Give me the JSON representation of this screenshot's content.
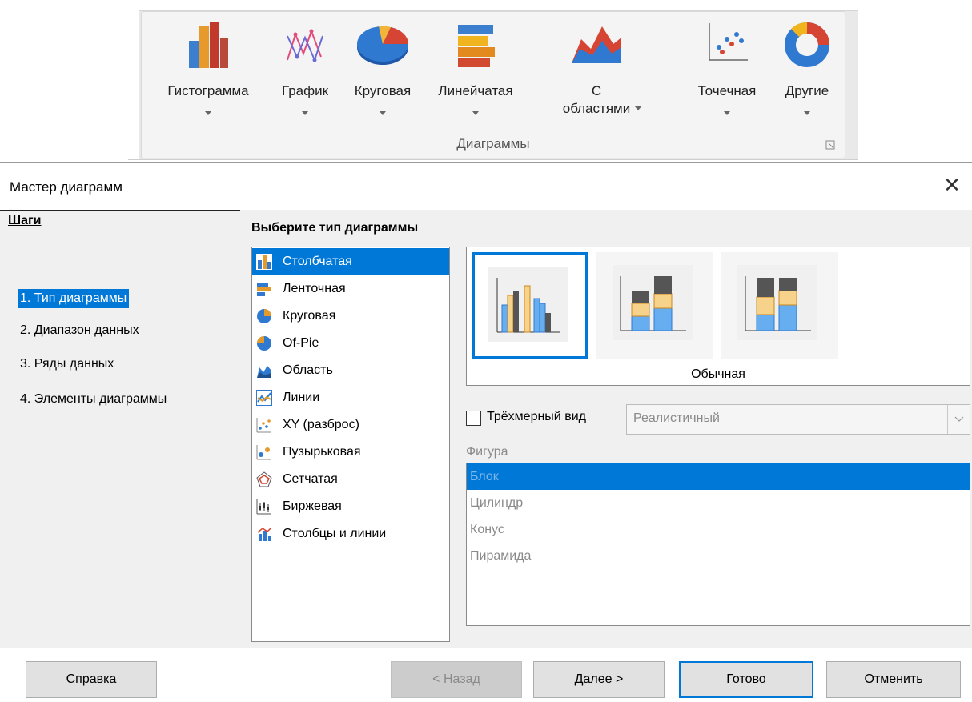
{
  "ribbon": {
    "buttons": [
      {
        "label": "Гистограмма",
        "icon": "column-chart-icon"
      },
      {
        "label": "График",
        "icon": "line-chart-icon"
      },
      {
        "label": "Круговая",
        "icon": "pie-chart-icon"
      },
      {
        "label": "Линейчатая",
        "icon": "bar-chart-icon"
      },
      {
        "label": "С",
        "label2": "областями",
        "icon": "area-chart-icon"
      },
      {
        "label": "Точечная",
        "icon": "scatter-chart-icon"
      },
      {
        "label": "Другие",
        "icon": "doughnut-chart-icon"
      }
    ],
    "group_label": "Диаграммы"
  },
  "dialog": {
    "title": "Мастер диаграмм",
    "close": "✕",
    "steps_title": "Шаги",
    "steps": [
      "1. Тип диаграммы",
      "2. Диапазон данных",
      "3. Ряды данных",
      "4. Элементы диаграммы"
    ],
    "choose_label": "Выберите тип диаграммы",
    "chart_types": [
      "Столбчатая",
      "Ленточная",
      "Круговая",
      "Of-Pie",
      "Область",
      "Линии",
      "XY (разброс)",
      "Пузырьковая",
      "Сетчатая",
      "Биржевая",
      "Столбцы и линии"
    ],
    "variant_label": "Обычная",
    "three_d_label": "Трёхмерный вид",
    "three_d_combo": "Реалистичный",
    "shape_label": "Фигура",
    "shapes": [
      "Блок",
      "Цилиндр",
      "Конус",
      "Пирамида"
    ]
  },
  "buttons": {
    "help": "Справка",
    "back": "< Назад",
    "next": "Далее >",
    "finish": "Готово",
    "cancel": "Отменить"
  },
  "colors": {
    "selection": "#0078d7",
    "panel_bg": "#f0f0f0"
  }
}
